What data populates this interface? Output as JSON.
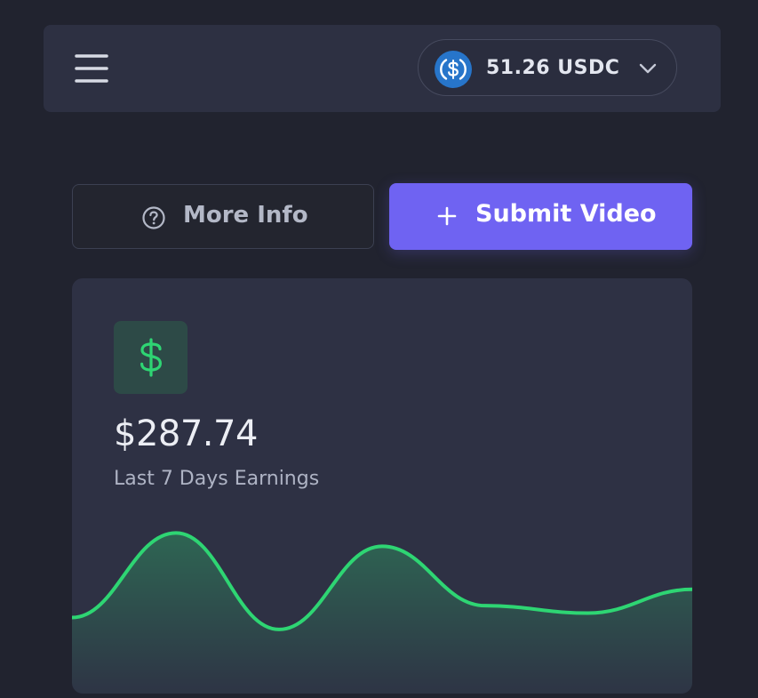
{
  "header": {
    "menu_icon": "hamburger-menu-icon",
    "wallet": {
      "token_icon": "usdc-coin-icon",
      "amount_label": "51.26 USDC",
      "chevron_icon": "chevron-down-icon"
    }
  },
  "actions": {
    "more_info": {
      "label": "More Info",
      "icon": "question-circle-icon"
    },
    "submit_video": {
      "label": "Submit Video",
      "icon": "plus-icon"
    }
  },
  "earnings": {
    "icon": "dollar-icon",
    "amount": "$287.74",
    "label": "Last 7 Days Earnings",
    "chart_data": {
      "type": "area",
      "values": [
        38,
        95,
        30,
        86,
        46,
        41,
        57
      ],
      "series_color": "#2ed573"
    }
  },
  "colors": {
    "accent": "#6f63f2",
    "positive": "#2ed573",
    "background": "#21232f",
    "surface": "#2e3144"
  }
}
